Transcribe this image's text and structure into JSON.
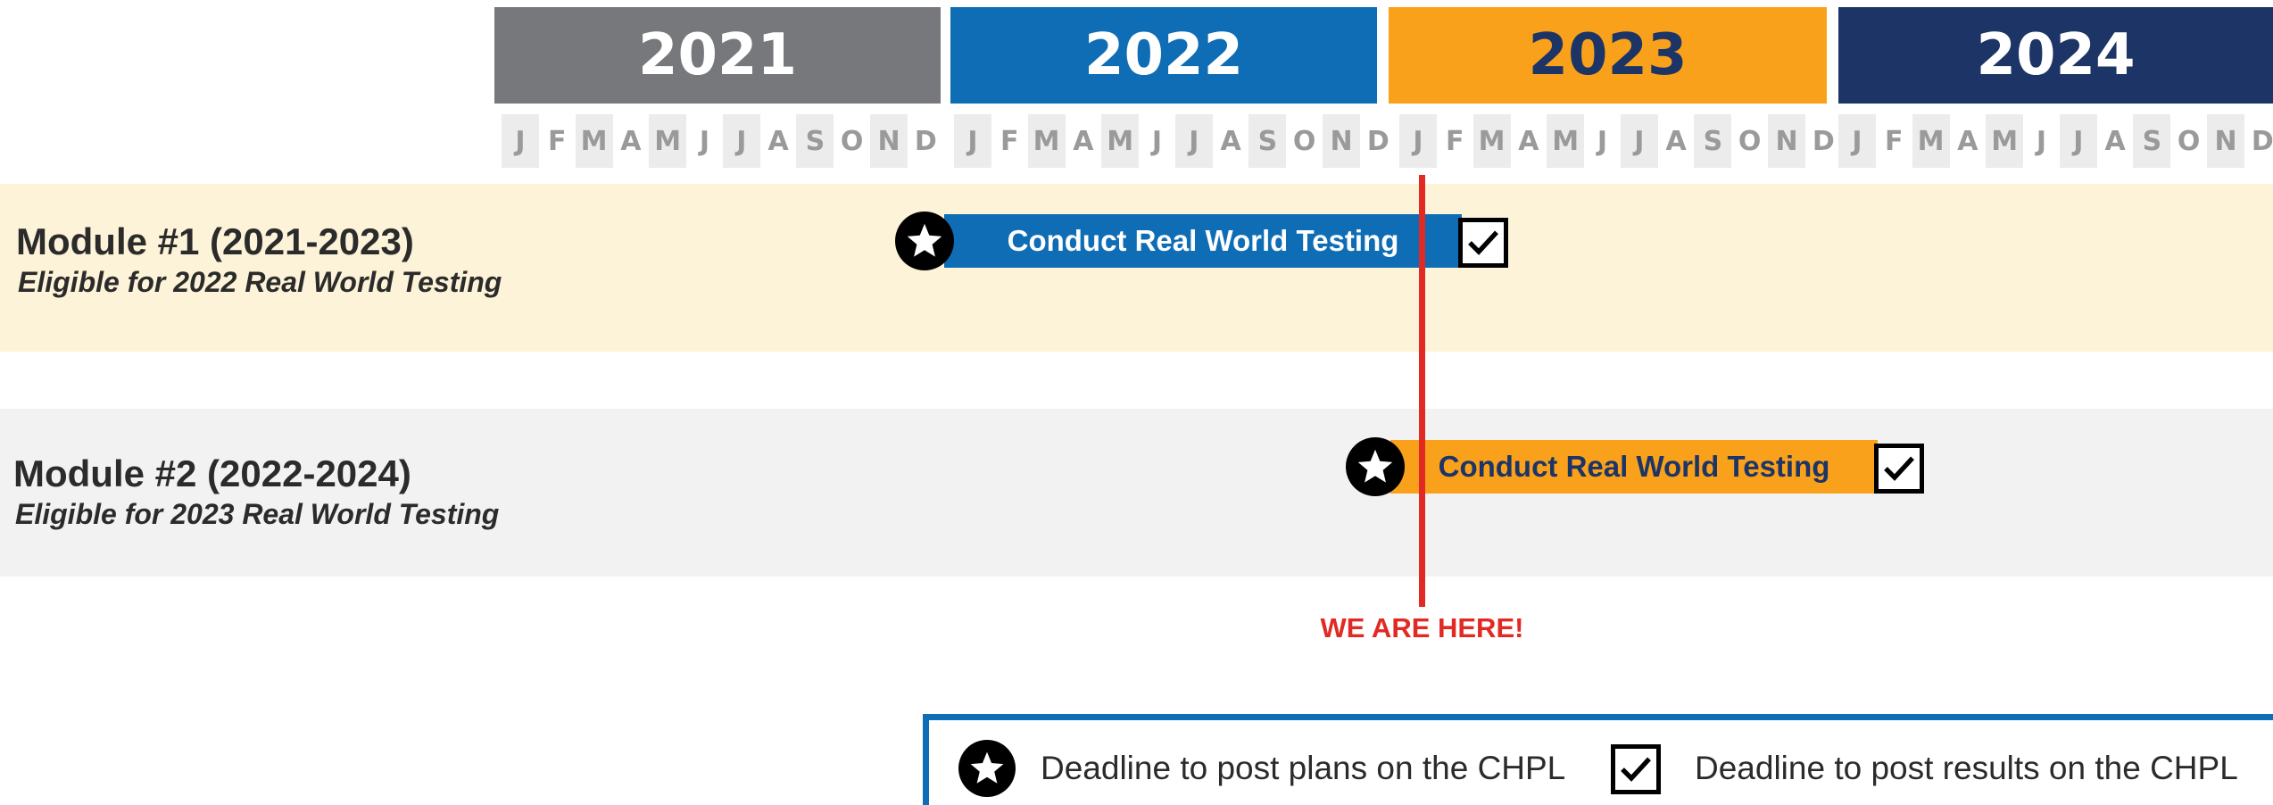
{
  "years": [
    {
      "label": "2021",
      "bg": "#77787b",
      "color": "#ffffff"
    },
    {
      "label": "2022",
      "bg": "#0f6db5",
      "color": "#ffffff"
    },
    {
      "label": "2023",
      "bg": "#f9a11b",
      "color": "#1d3566"
    },
    {
      "label": "2024",
      "bg": "#1d3566",
      "color": "#ffffff"
    }
  ],
  "months": [
    "J",
    "F",
    "M",
    "A",
    "M",
    "J",
    "J",
    "A",
    "S",
    "O",
    "N",
    "D"
  ],
  "modules": [
    {
      "title": "Module #1 (2021-2023)",
      "subtitle": "Eligible for 2022 Real World Testing",
      "band_color": "#fdf3d8",
      "bar_label": "Conduct Real World Testing",
      "bar_color": "#0f6db5",
      "bar_text_color": "#ffffff",
      "start_month": "2022-01",
      "end_month": "2023-02"
    },
    {
      "title": "Module #2 (2022-2024)",
      "subtitle": "Eligible for 2023 Real World Testing",
      "band_color": "#f2f2f2",
      "bar_label": "Conduct Real World Testing",
      "bar_color": "#f9a11b",
      "bar_text_color": "#1d3566",
      "start_month": "2023-01",
      "end_month": "2024-02"
    }
  ],
  "marker": {
    "label": "WE ARE HERE!",
    "color": "#e02a23"
  },
  "legend": {
    "plans_label": "Deadline to post plans on the CHPL",
    "results_label": "Deadline to post results on the CHPL",
    "plans_icon": "star-icon",
    "results_icon": "checkbox-icon",
    "border_color": "#0f6db5"
  }
}
